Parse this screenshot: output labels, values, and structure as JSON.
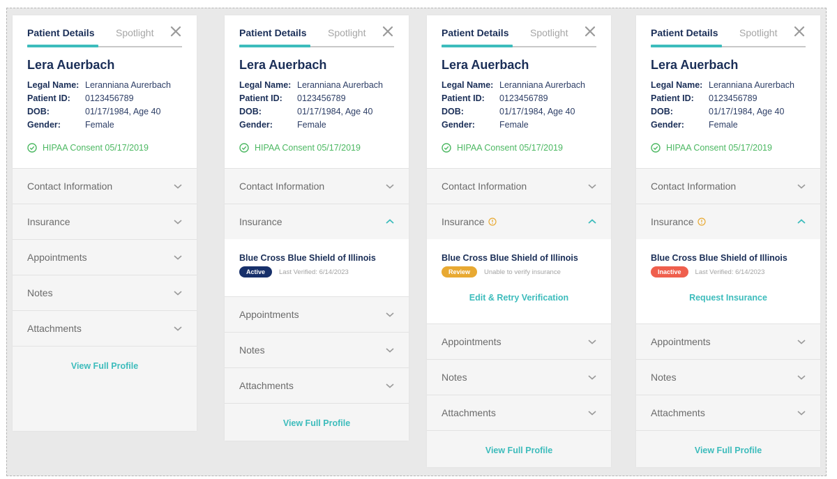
{
  "colors": {
    "navy": "#1a2e57",
    "teal": "#3dbcbc",
    "green": "#4cb862",
    "active_badge": "#17306a",
    "review_badge": "#e8a932",
    "inactive_badge": "#ef5f4d",
    "warning_icon": "#e8a932"
  },
  "common": {
    "tab_active": "Patient Details",
    "tab_inactive": "Spotlight",
    "patient_name": "Lera Auerbach",
    "fields": [
      {
        "label": "Legal Name:",
        "value": "Leranniana Aurerbach"
      },
      {
        "label": "Patient ID:",
        "value": "0123456789"
      },
      {
        "label": "DOB:",
        "value": "01/17/1984, Age 40"
      },
      {
        "label": "Gender:",
        "value": "Female"
      }
    ],
    "consent": "HIPAA Consent 05/17/2019",
    "sections": {
      "contact": "Contact Information",
      "insurance": "Insurance",
      "appointments": "Appointments",
      "notes": "Notes",
      "attachments": "Attachments"
    },
    "view_full_profile": "View Full Profile"
  },
  "panels": [
    {
      "insurance_expanded": false
    },
    {
      "insurance_expanded": true,
      "insurance": {
        "provider": "Blue Cross Blue Shield of Illinois",
        "status": "Active",
        "meta": "Last Verified: 6/14/2023"
      }
    },
    {
      "insurance_expanded": true,
      "insurance_warning": true,
      "insurance": {
        "provider": "Blue Cross Blue Shield of Illinois",
        "status": "Review",
        "meta": "Unable to verify insurance",
        "action": "Edit & Retry Verification"
      }
    },
    {
      "insurance_expanded": true,
      "insurance_warning": true,
      "insurance": {
        "provider": "Blue Cross Blue Shield of Illinois",
        "status": "Inactive",
        "meta": "Last Verified: 6/14/2023",
        "action": "Request Insurance"
      }
    }
  ]
}
